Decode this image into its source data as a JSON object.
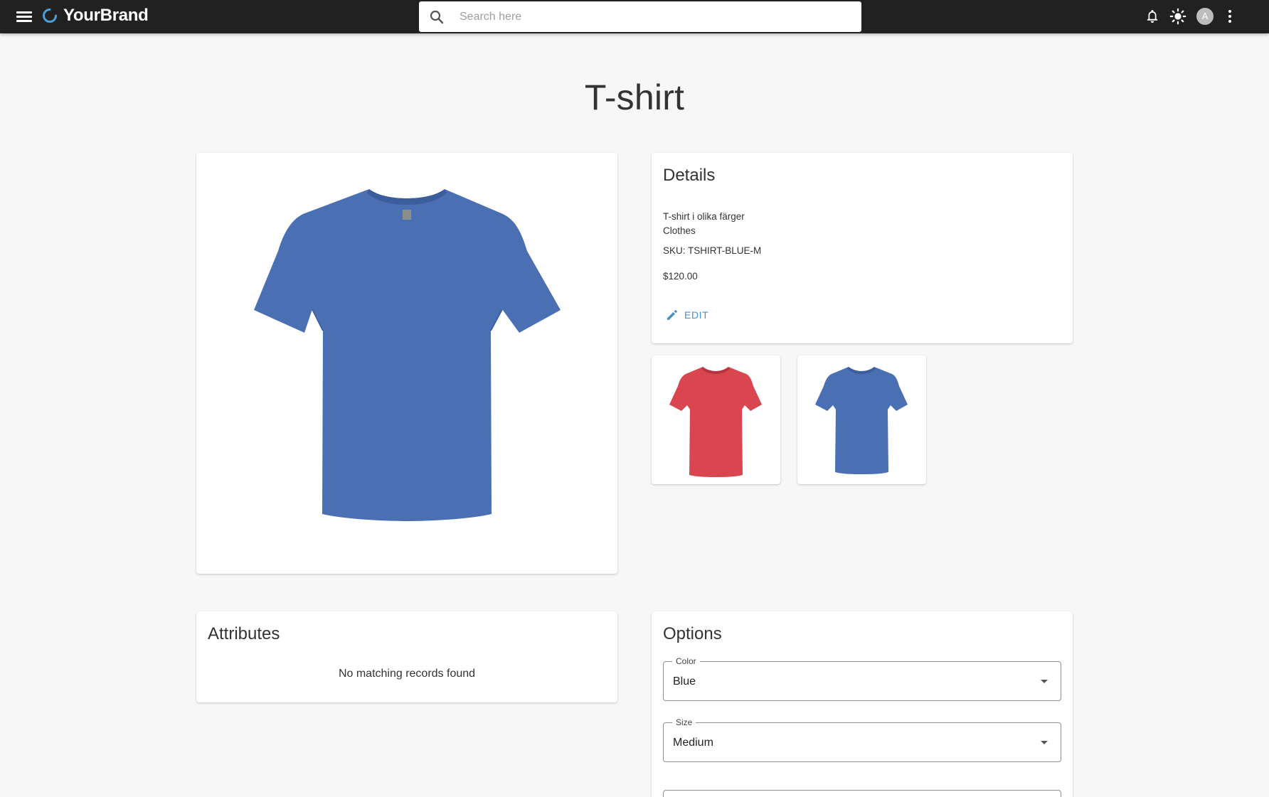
{
  "header": {
    "brand_name": "YourBrand",
    "search_placeholder": "Search here",
    "avatar_letter": "A",
    "brand_color": "#4a9fd8"
  },
  "page": {
    "title": "T-shirt"
  },
  "details": {
    "title": "Details",
    "description": "T-shirt i olika färger",
    "category": "Clothes",
    "sku": "SKU: TSHIRT-BLUE-M",
    "price": "$120.00",
    "edit_label": "EDIT",
    "accent_color": "#4a90c2"
  },
  "thumbnails": [
    {
      "color_name": "red",
      "color": "#d94650"
    },
    {
      "color_name": "blue",
      "color": "#4a6fb2"
    }
  ],
  "main_image": {
    "color": "#4a6fb2"
  },
  "attributes": {
    "title": "Attributes",
    "empty_message": "No matching records found"
  },
  "options": {
    "title": "Options",
    "fields": [
      {
        "label": "Color",
        "value": "Blue"
      },
      {
        "label": "Size",
        "value": "Medium"
      }
    ]
  }
}
